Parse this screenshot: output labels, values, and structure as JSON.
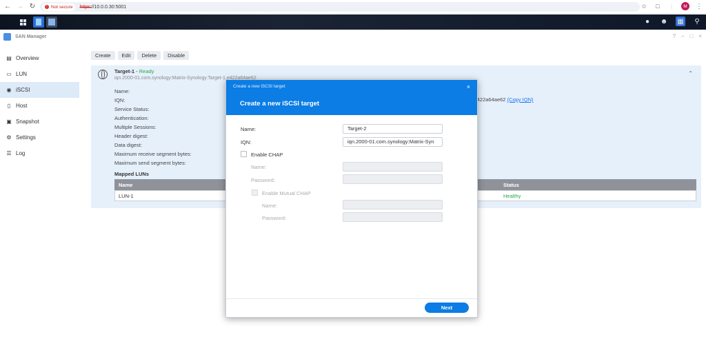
{
  "browser": {
    "security_label": "Not secure",
    "url_scheme": "https:",
    "url_rest": "//10.0.0.30:5001",
    "avatar_letter": "M"
  },
  "app": {
    "title": "SAN Manager"
  },
  "toolbar": {
    "create": "Create",
    "edit": "Edit",
    "delete": "Delete",
    "disable": "Disable"
  },
  "sidebar": {
    "items": [
      {
        "label": "Overview",
        "icon": "overview-icon"
      },
      {
        "label": "LUN",
        "icon": "lun-icon"
      },
      {
        "label": "iSCSI",
        "icon": "iscsi-icon"
      },
      {
        "label": "Host",
        "icon": "host-icon"
      },
      {
        "label": "Snapshot",
        "icon": "camera-icon"
      },
      {
        "label": "Settings",
        "icon": "gear-icon"
      },
      {
        "label": "Log",
        "icon": "list-icon"
      }
    ],
    "active": "iSCSI"
  },
  "target": {
    "name": "Target-1",
    "separator": "-",
    "status": "Ready",
    "iqn": "iqn.2000-01.com.synology:Matrix-Synology.Target-1.e422a64ae62",
    "iqn_tail": "c422a64ae62",
    "copy_iqn": "(Copy IQN)",
    "properties": [
      "Name:",
      "IQN:",
      "Service Status:",
      "Authentication:",
      "Multiple Sessions:",
      "Header digest:",
      "Data digest:",
      "Maximum receive segment bytes:",
      "Maximum send segment bytes:"
    ],
    "mapped_luns_title": "Mapped LUNs",
    "lun_table": {
      "headers": [
        "Name",
        "Status"
      ],
      "rows": [
        {
          "name": "LUN-1",
          "status": "Healthy"
        }
      ]
    }
  },
  "modal": {
    "window_title": "Create a new iSCSI target",
    "heading": "Create a new iSCSI target",
    "name_label": "Name:",
    "name_value": "Target-2",
    "iqn_label": "IQN:",
    "iqn_value": "iqn.2000-01.com.synology:Matrix-Syn",
    "enable_chap": "Enable CHAP",
    "chap_name_label": "Name:",
    "chap_password_label": "Password:",
    "enable_mutual_chap": "Enable Mutual CHAP",
    "mutual_name_label": "Name:",
    "mutual_password_label": "Password:",
    "next": "Next"
  },
  "colors": {
    "accent": "#0b7de4",
    "ready": "#28a745",
    "healthy": "#28a745",
    "link": "#1a73e8"
  }
}
